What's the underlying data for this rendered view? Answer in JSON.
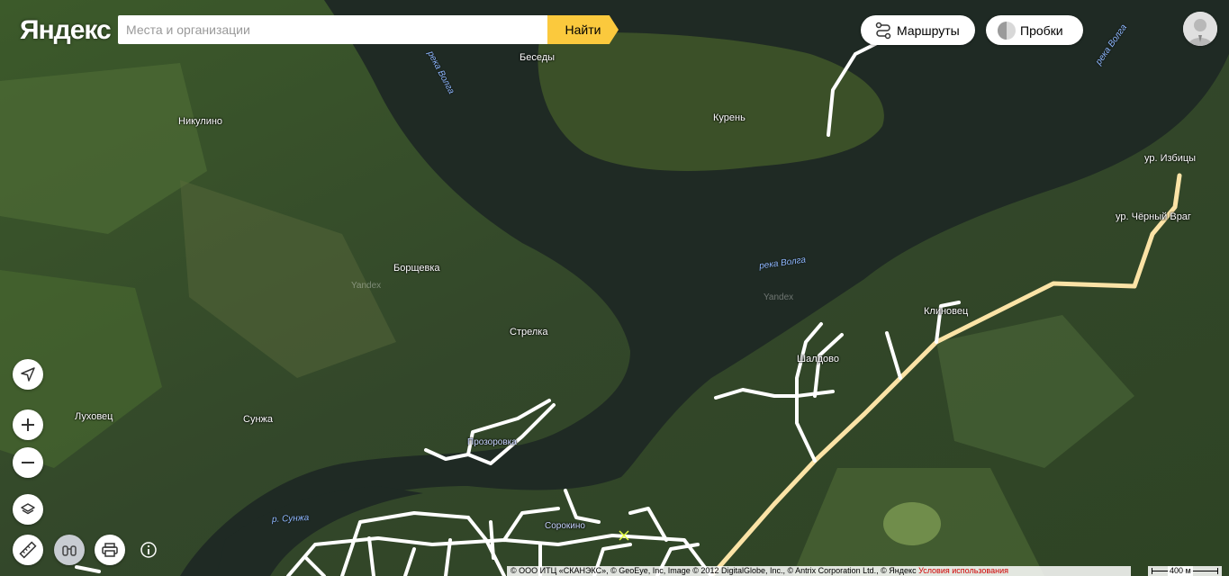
{
  "header": {
    "logo": "Яндекс",
    "search": {
      "placeholder": "Места и организации",
      "value": ""
    },
    "find_label": "Найти",
    "routes_label": "Маршруты",
    "traffic_label": "Пробки"
  },
  "map": {
    "places": [
      "Беседы",
      "Никулино",
      "Курень",
      "ур. Избицы",
      "ур. Чёрный Враг",
      "Борщевка",
      "Стрелка",
      "Клиновец",
      "Шалдово",
      "Луховец",
      "Сунжа",
      "Прозоровка",
      "Сорокино"
    ],
    "rivers": [
      "река Волга",
      "река Волга",
      "река Волга",
      "р. Сунжа"
    ],
    "watermarks": [
      "Yandex",
      "Yandex"
    ]
  },
  "footer": {
    "copyright": "© ООО ИТЦ «СКАНЭКС», © GeoEye, Inc, Image © 2012 DigitalGlobe, Inc., © Antrix Corporation Ltd., © Яндекс",
    "terms": "Условия использования",
    "scale": "400 м"
  },
  "icons": {
    "geolocation": "geolocation-icon",
    "zoom_in": "plus-icon",
    "zoom_out": "minus-icon",
    "layers": "layers-icon",
    "ruler": "ruler-icon",
    "panorama": "binoculars-icon",
    "print": "printer-icon",
    "info": "info-icon"
  },
  "colors": {
    "find_button": "#fbc93d",
    "highway": "#fbe3a6",
    "river": "#1f2a24",
    "river_label": "#8fb8ff",
    "terms_link": "#d00000"
  }
}
